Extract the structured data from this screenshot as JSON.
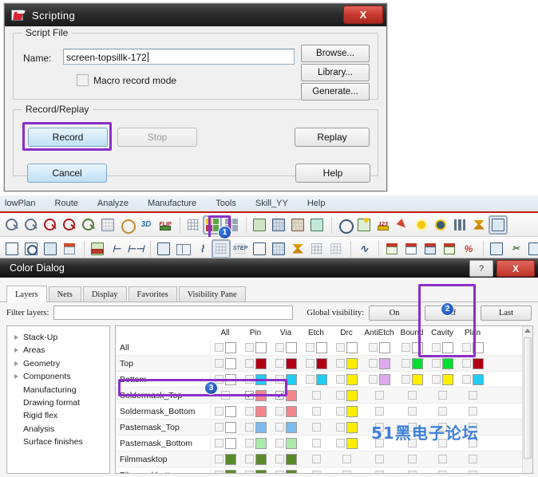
{
  "scripting": {
    "title": "Scripting",
    "close_label": "X",
    "script_file_legend": "Script File",
    "name_label": "Name:",
    "name_value": "screen-topsillk-172",
    "macro_checkbox_label": "Macro record mode",
    "browse_label": "Browse...",
    "library_label": "Library...",
    "generate_label": "Generate...",
    "record_replay_legend": "Record/Replay",
    "record_label": "Record",
    "stop_label": "Stop",
    "replay_label": "Replay",
    "cancel_label": "Cancel",
    "help_label": "Help"
  },
  "cad": {
    "menu": [
      "lowPlan",
      "Route",
      "Analyze",
      "Manufacture",
      "Tools",
      "Skill_YY",
      "Help"
    ],
    "toolbar_row1": [
      "zoom-fit-icon",
      "zoom-in-icon",
      "zoom-in-point-icon",
      "zoom-out-icon",
      "zoom-previous-icon",
      "zoom-world-icon",
      "redraw-icon",
      "view-3d-icon",
      "flip-design-icon",
      "sep",
      "grid-toggle-icon",
      "color-dialog-icon",
      "layer-priority-icon",
      "sep",
      "place-manual-icon",
      "quickplace-icon",
      "swap-components-icon",
      "autoplace-icon",
      "sep",
      "net-info-icon",
      "property-edit-icon",
      "dimension-icon",
      "highlight-icon",
      "light-icon",
      "spotlight-icon",
      "stripes-icon",
      "constraint-manager-icon",
      "options-icon"
    ],
    "toolbar_row2": [
      "shape-add-icon",
      "shape-circle-icon",
      "shape-delete-icon",
      "shape-merge-icon",
      "sep",
      "copper-pour-icon",
      "measure-h-icon",
      "measure-w-icon",
      "sep",
      "route-manual-icon",
      "route-book-icon",
      "slide-icon",
      "fanout-icon",
      "vias-icon",
      "label-icon",
      "drc-check-icon",
      "delay-tune-icon",
      "shield-icon",
      "z-copy-icon",
      "sep",
      "waveform-icon",
      "sep",
      "report-icon",
      "report-open-icon",
      "report-lock-icon",
      "report-check-icon",
      "report-edit-icon",
      "sep",
      "copy-icon",
      "cut-icon",
      "paste-icon"
    ],
    "badges": {
      "one": "1",
      "two": "2",
      "three": "3"
    }
  },
  "color_dialog": {
    "title": "Color Dialog",
    "help_label": "?",
    "close_label": "X",
    "tabs": [
      {
        "label": "Layers",
        "selected": true
      },
      {
        "label": "Nets",
        "selected": false
      },
      {
        "label": "Display",
        "selected": false
      },
      {
        "label": "Favorites",
        "selected": false
      },
      {
        "label": "Visibility Pane",
        "selected": false
      }
    ],
    "filter_label": "Filter layers:",
    "filter_value": "",
    "global_visibility_label": "Global visibility:",
    "global_buttons": [
      "On",
      "Off",
      "Last"
    ],
    "tree": [
      {
        "label": "Stack-Up",
        "expandable": true
      },
      {
        "label": "Areas",
        "expandable": true
      },
      {
        "label": "Geometry",
        "expandable": true
      },
      {
        "label": "Components",
        "expandable": true
      },
      {
        "label": "Manufacturing",
        "expandable": false
      },
      {
        "label": "Drawing format",
        "expandable": false
      },
      {
        "label": "Rigid flex",
        "expandable": false
      },
      {
        "label": "Analysis",
        "expandable": false
      },
      {
        "label": "Surface finishes",
        "expandable": false
      }
    ],
    "columns": [
      "All",
      "Pin",
      "Via",
      "Etch",
      "Drc",
      "AntiEtch",
      "Bound",
      "Cavity",
      "Plan"
    ],
    "rows": [
      {
        "name": "All",
        "highlighted": false,
        "cells": [
          {
            "checked": false,
            "color": "#ffffff"
          },
          {
            "checked": false,
            "color": "#ffffff"
          },
          {
            "checked": false,
            "color": "#ffffff"
          },
          {
            "checked": false,
            "color": "#ffffff"
          },
          {
            "checked": false,
            "color": "#ffffff"
          },
          {
            "checked": false,
            "color": "#ffffff"
          },
          {
            "checked": false,
            "color": "#ffffff"
          },
          {
            "checked": false,
            "color": "#ffffff"
          },
          {
            "checked": false,
            "color": "#ffffff"
          }
        ]
      },
      {
        "name": "Top",
        "highlighted": false,
        "cells": [
          {
            "checked": false,
            "color": "#ffffff"
          },
          {
            "checked": false,
            "color": "#b00014"
          },
          {
            "checked": false,
            "color": "#b00014"
          },
          {
            "checked": false,
            "color": "#b00014"
          },
          {
            "checked": false,
            "color": "#ffee00"
          },
          {
            "checked": false,
            "color": "#ddaaee"
          },
          {
            "checked": false,
            "color": "#00dd33"
          },
          {
            "checked": false,
            "color": "#00dd33"
          },
          {
            "checked": false,
            "color": "#b00014"
          }
        ]
      },
      {
        "name": "Bottom",
        "highlighted": false,
        "cells": [
          {
            "checked": false,
            "color": "#ffffff"
          },
          {
            "checked": false,
            "color": "#22ccf2"
          },
          {
            "checked": false,
            "color": "#22ccf2"
          },
          {
            "checked": false,
            "color": "#22ccf2"
          },
          {
            "checked": false,
            "color": "#ffee00"
          },
          {
            "checked": false,
            "color": "#ddaaee"
          },
          {
            "checked": false,
            "color": "#ffee00"
          },
          {
            "checked": false,
            "color": "#ffee00"
          },
          {
            "checked": false,
            "color": "#22ccf2"
          }
        ]
      },
      {
        "name": "Soldermask_Top",
        "highlighted": true,
        "cells": [
          {
            "checked": false,
            "color": "none"
          },
          {
            "checked": true,
            "color": "#f2868c"
          },
          {
            "checked": true,
            "color": "#f2868c"
          },
          {
            "checked": false,
            "color": "none"
          },
          {
            "checked": false,
            "color": "#ffee00"
          },
          {
            "checked": false,
            "color": "none"
          },
          {
            "checked": false,
            "color": "none"
          },
          {
            "checked": false,
            "color": "none"
          },
          {
            "checked": false,
            "color": "none"
          }
        ]
      },
      {
        "name": "Soldermask_Bottom",
        "highlighted": false,
        "cells": [
          {
            "checked": false,
            "color": "#ffffff"
          },
          {
            "checked": false,
            "color": "#f2868c"
          },
          {
            "checked": false,
            "color": "#f2868c"
          },
          {
            "checked": false,
            "color": "none"
          },
          {
            "checked": false,
            "color": "#ffee00"
          },
          {
            "checked": false,
            "color": "none"
          },
          {
            "checked": false,
            "color": "none"
          },
          {
            "checked": false,
            "color": "none"
          },
          {
            "checked": false,
            "color": "none"
          }
        ]
      },
      {
        "name": "Pastemask_Top",
        "highlighted": false,
        "cells": [
          {
            "checked": false,
            "color": "#ffffff"
          },
          {
            "checked": false,
            "color": "#7cbcec"
          },
          {
            "checked": false,
            "color": "#7cbcec"
          },
          {
            "checked": false,
            "color": "none"
          },
          {
            "checked": false,
            "color": "#ffee00"
          },
          {
            "checked": false,
            "color": "none"
          },
          {
            "checked": false,
            "color": "none"
          },
          {
            "checked": false,
            "color": "none"
          },
          {
            "checked": false,
            "color": "none"
          }
        ]
      },
      {
        "name": "Pastemask_Bottom",
        "highlighted": false,
        "cells": [
          {
            "checked": false,
            "color": "#ffffff"
          },
          {
            "checked": false,
            "color": "#abeaab"
          },
          {
            "checked": false,
            "color": "#abeaab"
          },
          {
            "checked": false,
            "color": "none"
          },
          {
            "checked": false,
            "color": "#ffee00"
          },
          {
            "checked": false,
            "color": "none"
          },
          {
            "checked": false,
            "color": "none"
          },
          {
            "checked": false,
            "color": "none"
          },
          {
            "checked": false,
            "color": "none"
          }
        ]
      },
      {
        "name": "Filmmasktop",
        "highlighted": false,
        "cells": [
          {
            "checked": false,
            "color": "#5a8a2a"
          },
          {
            "checked": false,
            "color": "#5a8a2a"
          },
          {
            "checked": false,
            "color": "#5a8a2a"
          },
          {
            "checked": false,
            "color": "none"
          },
          {
            "checked": false,
            "color": "none"
          },
          {
            "checked": false,
            "color": "none"
          },
          {
            "checked": false,
            "color": "none"
          },
          {
            "checked": false,
            "color": "none"
          },
          {
            "checked": false,
            "color": "none"
          }
        ]
      },
      {
        "name": "Filmmaskbottom",
        "highlighted": false,
        "cells": [
          {
            "checked": false,
            "color": "#5a8a2a"
          },
          {
            "checked": false,
            "color": "#5a8a2a"
          },
          {
            "checked": false,
            "color": "#5a8a2a"
          },
          {
            "checked": false,
            "color": "none"
          },
          {
            "checked": false,
            "color": "none"
          },
          {
            "checked": false,
            "color": "none"
          },
          {
            "checked": false,
            "color": "none"
          },
          {
            "checked": false,
            "color": "none"
          },
          {
            "checked": false,
            "color": "none"
          }
        ]
      }
    ]
  },
  "watermark": "51黑电子论坛",
  "colors": {
    "highlight": "#8b2fc9",
    "badge": "#1746a8",
    "menu_underline": "#c21c1c"
  }
}
